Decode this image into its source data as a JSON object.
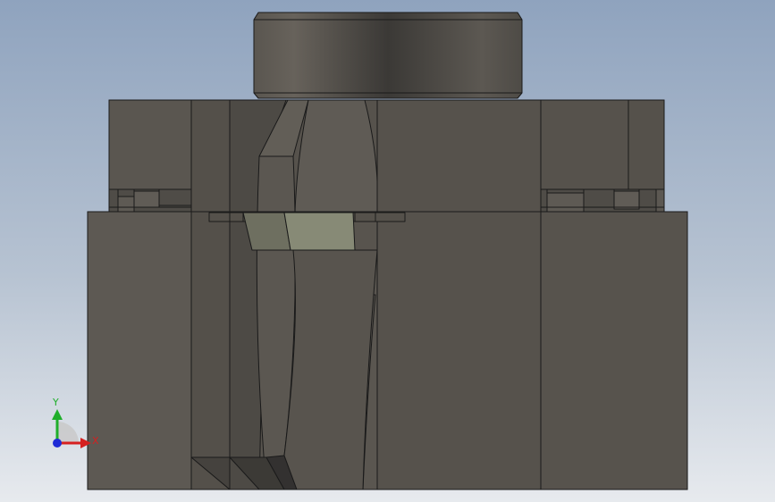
{
  "viewport": {
    "background_top": "#8fa3be",
    "background_bottom": "#e7eaee",
    "model_color": "#57534d",
    "edge_color": "#1a1a1a",
    "highlight_color": "#8a8a78"
  },
  "triad": {
    "x_label": "X",
    "y_label": "Y",
    "x_color": "#d62020",
    "y_color": "#1fae2a",
    "z_color": "#1f2bd6"
  }
}
